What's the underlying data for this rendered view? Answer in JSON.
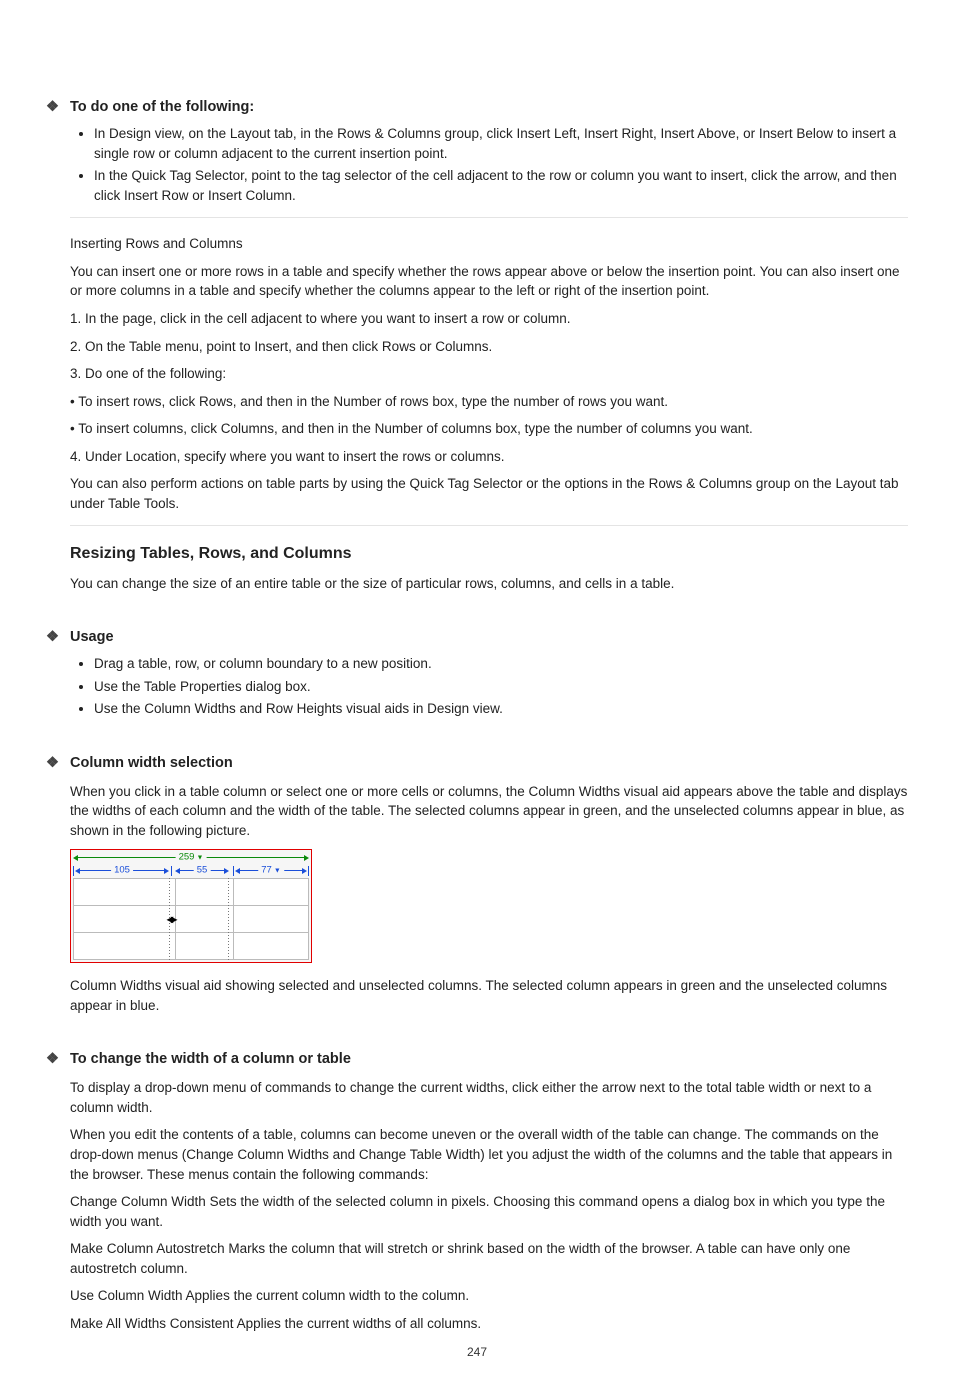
{
  "page": {
    "number": "247"
  },
  "section1": {
    "heading": "To do one of the following:",
    "items": [
      "In Design view, on the Layout tab, in the Rows & Columns group, click Insert Left, Insert Right, Insert Above, or Insert Below to insert a single row or column adjacent to the current insertion point.",
      "In the Quick Tag Selector, point to the tag selector of the cell adjacent to the row or column you want to insert, click the arrow, and then click Insert Row or Insert Column."
    ]
  },
  "insertRC": {
    "p0": "Inserting Rows and Columns",
    "p1": "You can insert one or more rows in a table and specify whether the rows appear above or below the insertion point. You can also insert one or more columns in a table and specify whether the columns appear to the left or right of the insertion point.",
    "p2": "1. In the page, click in the cell adjacent to where you want to insert a row or column.",
    "p3": "2. On the Table menu, point to Insert, and then click Rows or Columns.",
    "p4": "3. Do one of the following:",
    "p5": "   • To insert rows, click Rows, and then in the Number of rows box, type the number of rows you want.",
    "p6": "   • To insert columns, click Columns, and then in the Number of columns box, type the number of columns you want.",
    "p7": "4. Under Location, specify where you want to insert the rows or columns.",
    "p8": "You can also perform actions on table parts by using the Quick Tag Selector or the options in the Rows & Columns group on the Layout tab under Table Tools."
  },
  "resizing": {
    "heading": "Resizing Tables, Rows, and Columns",
    "intro": "You can change the size of an entire table or the size of particular rows, columns, and cells in a table.",
    "usageHeading": "Usage",
    "usageItems": [
      "Drag a table, row, or column boundary to a new position.",
      "Use the Table Properties dialog box.",
      "Use the Column Widths and Row Heights visual aids in Design view."
    ]
  },
  "colwidth": {
    "heading": "Column width selection",
    "para": "When you click in a table column or select one or more cells or columns, the Column Widths visual aid appears above the table and displays the widths of each column and the width of the table. The selected columns appear in green, and the unselected columns appear in blue, as shown in the following picture.",
    "figure": {
      "totalWidth": "259",
      "col1": "105",
      "col2": "55",
      "col3": "77"
    },
    "caption": "Column Widths visual aid showing selected and unselected columns. The selected column appears in green and the unselected columns appear in blue."
  },
  "changeW": {
    "heading": "To change the width of a column or table",
    "p0": "To display a drop-down menu of commands to change the current widths, click either the arrow next to the total table width or next to a column width.",
    "p1": "When you edit the contents of a table, columns can become uneven or the overall width of the table can change. The commands on the drop-down menus (Change Column Widths and Change Table Width) let you adjust the width of the columns and the table that appears in the browser. These menus contain the following commands:",
    "p2": "Change Column Width  Sets the width of the selected column in pixels. Choosing this command opens a dialog box in which you type the width you want.",
    "p3": "Make Column Autostretch  Marks the column that will stretch or shrink based on the width of the browser. A table can have only one autostretch column.",
    "p4": "Use Column Width  Applies the current column width to the column.",
    "p5": "Make All Widths Consistent  Applies the current widths of all columns."
  }
}
